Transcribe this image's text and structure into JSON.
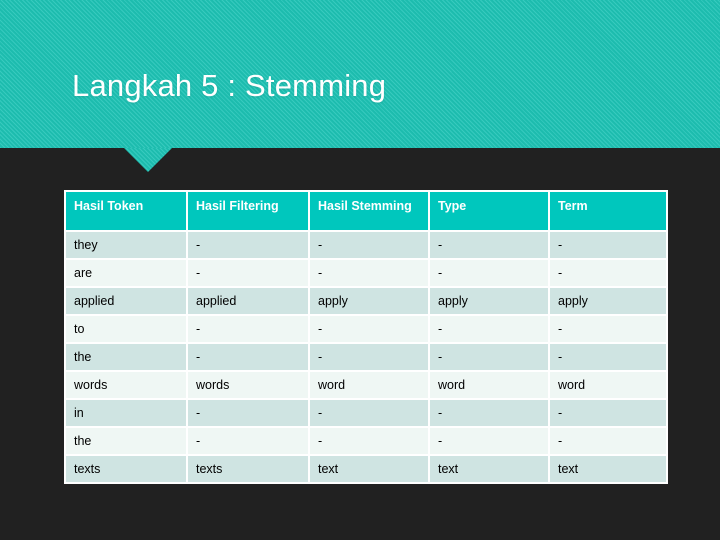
{
  "slide": {
    "title": "Langkah 5 : Stemming",
    "background_color": "#212121",
    "banner_color": "#1ec4b6",
    "header_cell_color": "#00c7bd",
    "row_odd_color": "#cfe4e2",
    "row_even_color": "#eff7f4"
  },
  "table": {
    "columns": [
      "Hasil Token",
      "Hasil Filtering",
      "Hasil Stemming",
      "Type",
      "Term"
    ],
    "rows": [
      [
        "they",
        "-",
        "-",
        "-",
        "-"
      ],
      [
        "are",
        "-",
        "-",
        "-",
        "-"
      ],
      [
        "applied",
        "applied",
        "apply",
        "apply",
        "apply"
      ],
      [
        "to",
        "-",
        "-",
        "-",
        "-"
      ],
      [
        "the",
        "-",
        "-",
        "-",
        "-"
      ],
      [
        "words",
        "words",
        "word",
        "word",
        "word"
      ],
      [
        "in",
        "-",
        "-",
        "-",
        "-"
      ],
      [
        "the",
        "-",
        "-",
        "-",
        "-"
      ],
      [
        "texts",
        "texts",
        "text",
        "text",
        "text"
      ]
    ]
  }
}
